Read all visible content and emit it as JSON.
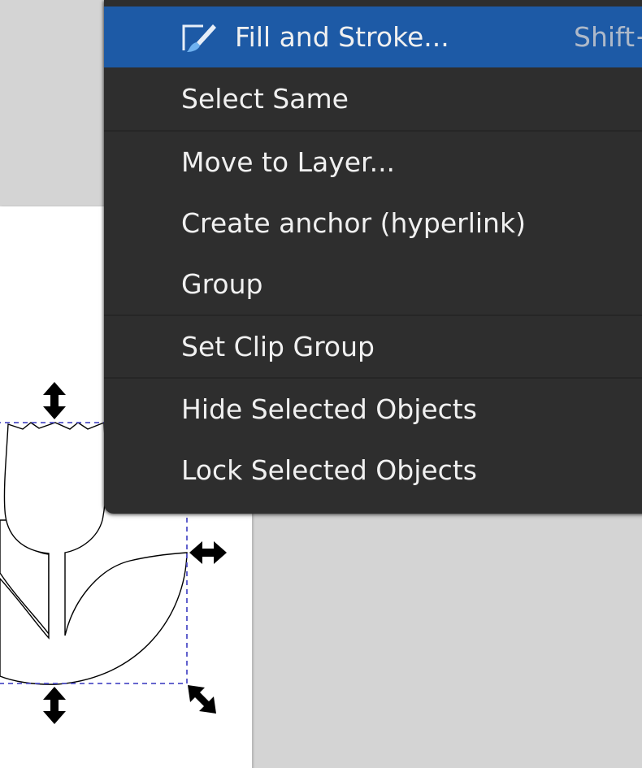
{
  "context_menu": {
    "items": [
      {
        "label": "Fill and Stroke...",
        "shortcut": "Shift+",
        "icon": "paintbrush-icon",
        "highlighted": true
      },
      {
        "label": "Select Same"
      },
      {
        "label": "Move to Layer..."
      },
      {
        "label": "Create anchor (hyperlink)"
      },
      {
        "label": "Group"
      },
      {
        "label": "Set Clip Group"
      },
      {
        "label": "Hide Selected Objects"
      },
      {
        "label": "Lock Selected Objects"
      }
    ]
  },
  "colors": {
    "menu_background": "#2e2e2e",
    "menu_highlight": "#1d5aa6",
    "canvas_background": "#d4d4d4",
    "page_background": "#ffffff",
    "selection_box": "#5050c8"
  },
  "canvas": {
    "handles": [
      "scale-vertical-arrow-icon",
      "scale-horizontal-arrow-icon",
      "scale-diagonal-arrow-icon"
    ]
  }
}
